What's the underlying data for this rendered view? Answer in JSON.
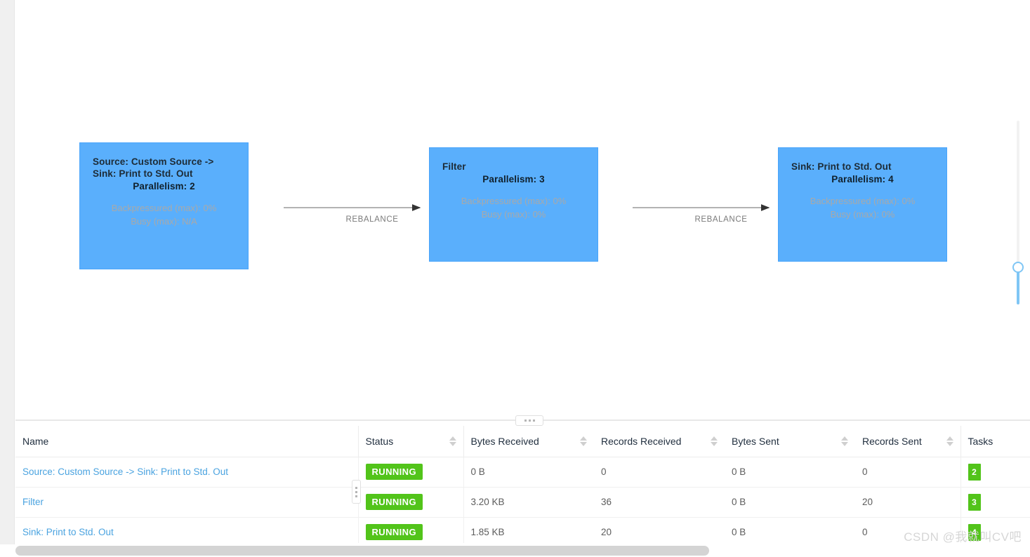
{
  "graph": {
    "nodes": [
      {
        "id": "source",
        "title": "Source: Custom Source -> Sink: Print to Std. Out",
        "parallelism": "Parallelism: 2",
        "backpressured": "Backpressured (max): 0%",
        "busy": "Busy (max): N/A"
      },
      {
        "id": "filter",
        "title": "Filter",
        "parallelism": "Parallelism: 3",
        "backpressured": "Backpressured (max): 0%",
        "busy": "Busy (max): 0%"
      },
      {
        "id": "sink",
        "title": "Sink: Print to Std. Out",
        "parallelism": "Parallelism: 4",
        "backpressured": "Backpressured (max): 0%",
        "busy": "Busy (max): 0%"
      }
    ],
    "edges": [
      {
        "id": "edge-1",
        "label": "REBALANCE"
      },
      {
        "id": "edge-2",
        "label": "REBALANCE"
      }
    ],
    "node_color": "#5aaffc",
    "edge_color": "#9a9a9a"
  },
  "zoom_slider": {
    "name": "zoom-slider",
    "accent": "#7fc6f5"
  },
  "table": {
    "columns": [
      {
        "key": "name",
        "label": "Name",
        "sortable": false
      },
      {
        "key": "status",
        "label": "Status",
        "sortable": true
      },
      {
        "key": "bytes_received",
        "label": "Bytes Received",
        "sortable": true
      },
      {
        "key": "records_received",
        "label": "Records Received",
        "sortable": true
      },
      {
        "key": "bytes_sent",
        "label": "Bytes Sent",
        "sortable": true
      },
      {
        "key": "records_sent",
        "label": "Records Sent",
        "sortable": true
      },
      {
        "key": "tasks",
        "label": "Tasks",
        "sortable": false
      }
    ],
    "rows": [
      {
        "name": "Source: Custom Source -> Sink: Print to Std. Out",
        "status": "RUNNING",
        "bytes_received": "0 B",
        "records_received": "0",
        "bytes_sent": "0 B",
        "records_sent": "0",
        "tasks": "2"
      },
      {
        "name": "Filter",
        "status": "RUNNING",
        "bytes_received": "3.20 KB",
        "records_received": "36",
        "bytes_sent": "0 B",
        "records_sent": "20",
        "tasks": "3"
      },
      {
        "name": "Sink: Print to Std. Out",
        "status": "RUNNING",
        "bytes_received": "1.85 KB",
        "records_received": "20",
        "bytes_sent": "0 B",
        "records_sent": "0",
        "tasks": "4"
      }
    ],
    "status_color": "#52c41a",
    "link_color": "#4aa3e0"
  },
  "watermark": {
    "text": "CSDN @我就叫CV吧"
  }
}
